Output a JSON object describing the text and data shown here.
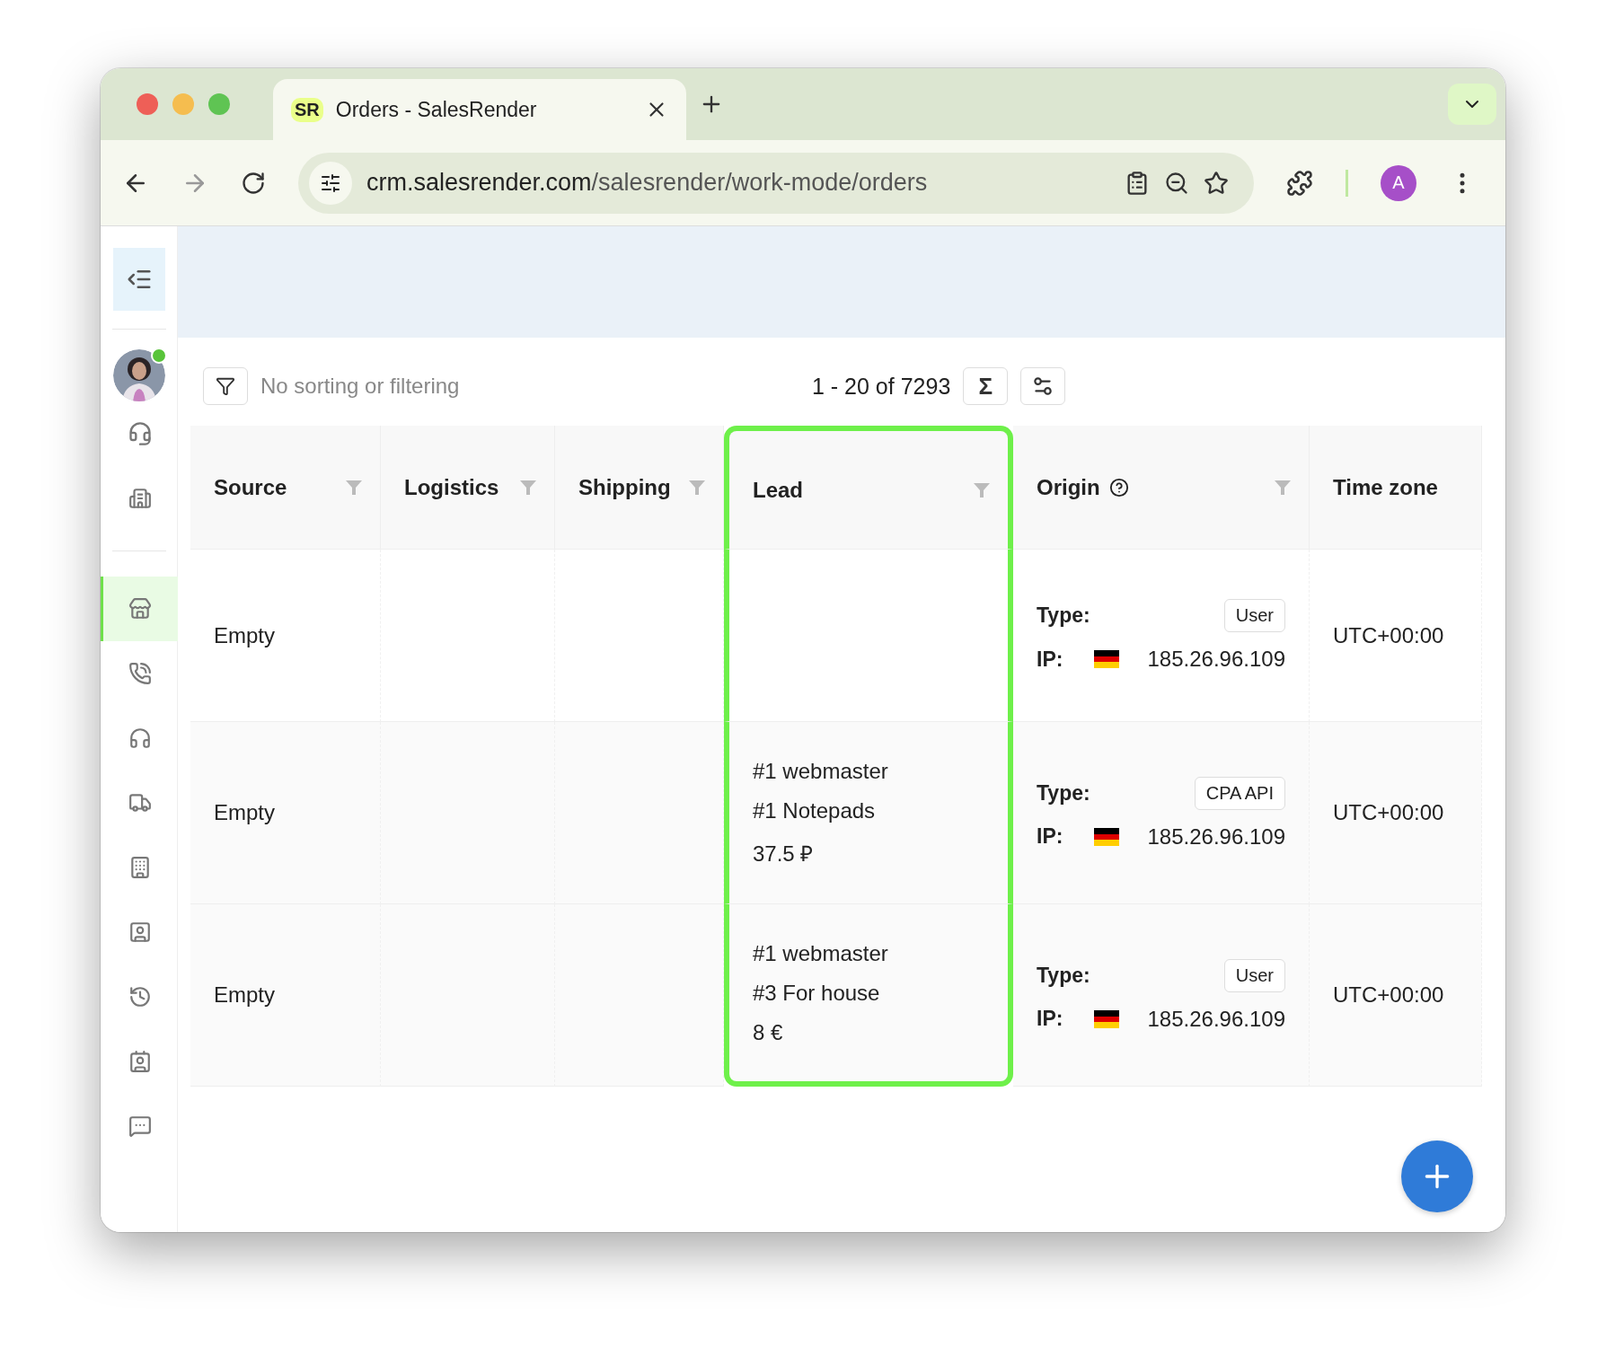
{
  "browser": {
    "tab": {
      "favicon": "SR",
      "title": "Orders - SalesRender"
    },
    "url_host": "crm.salesrender.com",
    "url_path": "/salesrender/work-mode/orders",
    "profile": "A"
  },
  "sidebar": {
    "items": [
      {
        "kind": "store",
        "selected": true
      },
      {
        "kind": "phone",
        "selected": false
      },
      {
        "kind": "headphones",
        "selected": false
      },
      {
        "kind": "truck",
        "selected": false
      },
      {
        "kind": "building",
        "selected": false
      },
      {
        "kind": "badge",
        "selected": false
      },
      {
        "kind": "history",
        "selected": false
      },
      {
        "kind": "contact",
        "selected": false
      },
      {
        "kind": "chat",
        "selected": false
      }
    ],
    "user_online": true
  },
  "toolbar": {
    "filter_text": "No sorting or filtering",
    "range": "1 - 20 of 7293",
    "sum_symbol": "Σ"
  },
  "table": {
    "columns": [
      {
        "label": "Source",
        "filter": true,
        "help": false,
        "highlighted": false
      },
      {
        "label": "Logistics",
        "filter": true,
        "help": false,
        "highlighted": false
      },
      {
        "label": "Shipping",
        "filter": true,
        "help": false,
        "highlighted": false
      },
      {
        "label": "Lead",
        "filter": true,
        "help": false,
        "highlighted": true
      },
      {
        "label": "Origin",
        "filter": true,
        "help": true,
        "highlighted": false
      },
      {
        "label": "Time zone",
        "filter": false,
        "help": false,
        "highlighted": false
      }
    ],
    "rows": [
      {
        "source": "Empty",
        "lead": [],
        "type_label": "Type:",
        "type": "User",
        "ip_label": "IP:",
        "ip": "185.26.96.109",
        "timezone": "UTC+00:00"
      },
      {
        "source": "Empty",
        "lead": [
          "#1 webmaster",
          "#1 Notepads",
          "37.5 ₽"
        ],
        "type_label": "Type:",
        "type": "CPA API",
        "ip_label": "IP:",
        "ip": "185.26.96.109",
        "timezone": "UTC+00:00"
      },
      {
        "source": "Empty",
        "lead": [
          "#1 webmaster",
          "#3 For house",
          "8 €"
        ],
        "type_label": "Type:",
        "type": "User",
        "ip_label": "IP:",
        "ip": "185.26.96.109",
        "timezone": "UTC+00:00"
      }
    ]
  }
}
